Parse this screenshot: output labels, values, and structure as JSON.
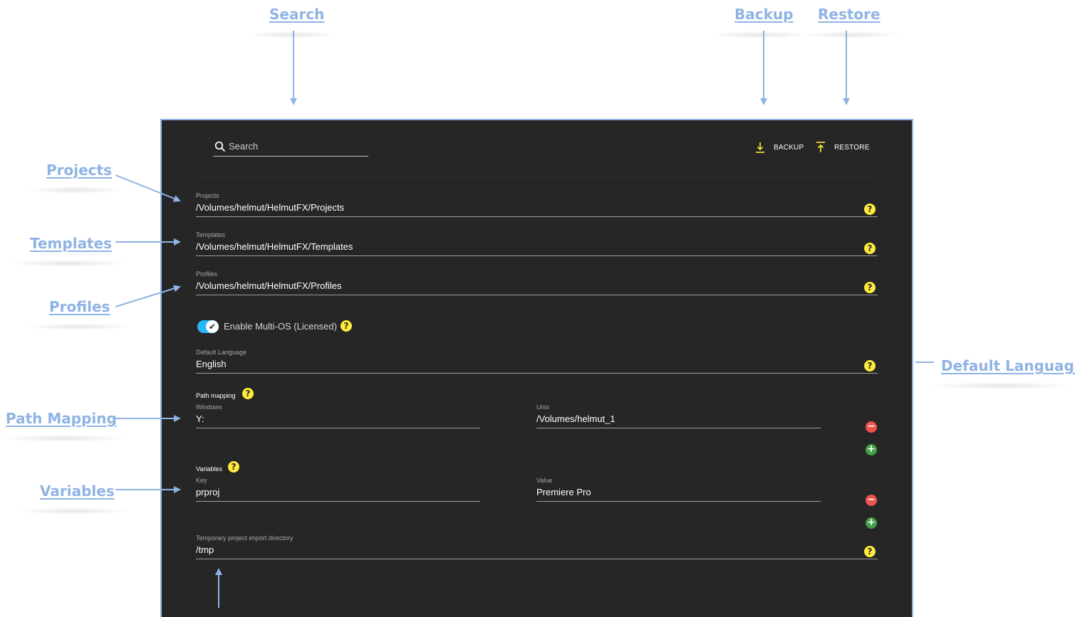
{
  "annotations": {
    "search": "Search",
    "backup": "Backup",
    "restore": "Restore",
    "projects": "Projects",
    "templates": "Templates",
    "profiles": "Profiles",
    "default_language": "Default Language",
    "path_mapping": "Path Mapping",
    "variables": "Variables"
  },
  "toolbar": {
    "search_placeholder": "Search",
    "backup_label": "BACKUP",
    "restore_label": "RESTORE",
    "accent_color": "#ffeb3b"
  },
  "fields": {
    "projects": {
      "label": "Projects",
      "value": "/Volumes/helmut/HelmutFX/Projects"
    },
    "templates": {
      "label": "Templates",
      "value": "/Volumes/helmut/HelmutFX/Templates"
    },
    "profiles": {
      "label": "Profiles",
      "value": "/Volumes/helmut/HelmutFX/Profiles"
    },
    "default_language": {
      "label": "Default Language",
      "value": "English"
    },
    "temp_dir": {
      "label": "Temporary project import directory",
      "value": "/tmp"
    }
  },
  "multi_os": {
    "label": "Enable Multi-OS (Licensed)",
    "enabled": true
  },
  "path_mapping": {
    "title": "Path mapping",
    "windows_label": "Windows",
    "windows_value": "Y:",
    "unix_label": "Unix",
    "unix_value": "/Volumes/helmut_1"
  },
  "variables": {
    "title": "Variables",
    "key_label": "Key",
    "key_value": "prproj",
    "value_label": "Value",
    "value_value": "Premiere Pro"
  },
  "icons": {
    "help": "?",
    "remove": "−",
    "add": "+",
    "check": "✔"
  },
  "colors": {
    "panel_bg": "#262626",
    "annotation": "#8fb3e3",
    "help_yellow": "#ffeb3b",
    "toggle_blue": "#29b6f6",
    "remove_red": "#ef5350",
    "add_green": "#43a047"
  }
}
